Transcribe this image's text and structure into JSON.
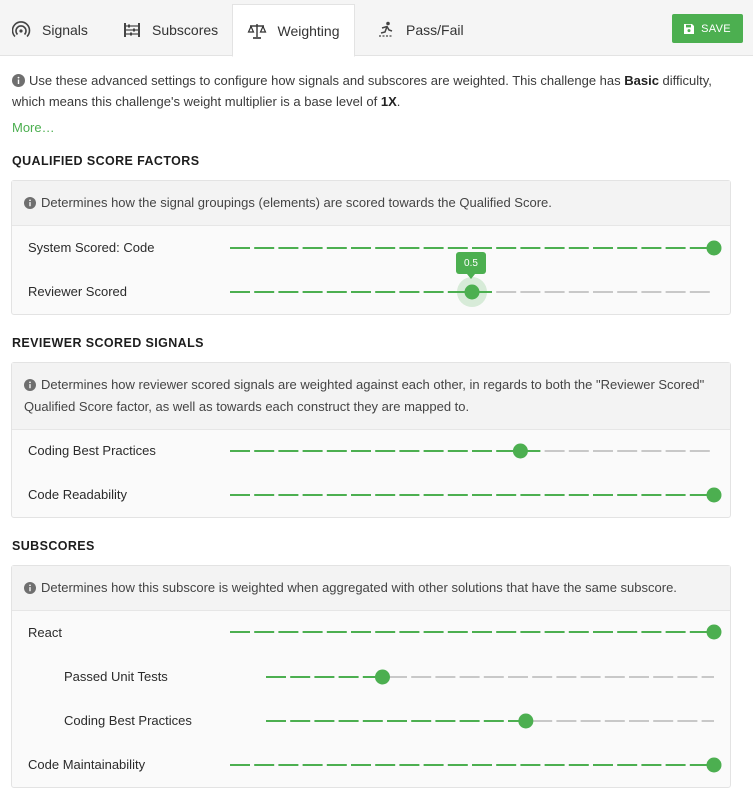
{
  "tabs": [
    {
      "label": "Signals",
      "icon": "signal-icon"
    },
    {
      "label": "Subscores",
      "icon": "abacus-icon"
    },
    {
      "label": "Weighting",
      "icon": "scale-icon"
    },
    {
      "label": "Pass/Fail",
      "icon": "hurdle-icon"
    }
  ],
  "active_tab": "Weighting",
  "save_label": "SAVE",
  "intro": {
    "text_1": "Use these advanced settings to configure how signals and subscores are weighted. This challenge has ",
    "difficulty": "Basic",
    "text_2": " difficulty, which means this challenge's weight multiplier is a base level of ",
    "multiplier": "1X",
    "text_3": ".",
    "more_link": "More…"
  },
  "colors": {
    "accent": "#4caf50",
    "track_inactive": "#c8c8c8"
  },
  "sections": {
    "qualified": {
      "title": "QUALIFIED SCORE FACTORS",
      "note": "Determines how the signal groupings (elements) are scored towards the Qualified Score.",
      "rows": [
        {
          "label": "System Scored: Code",
          "value": 1.0
        },
        {
          "label": "Reviewer Scored",
          "value": 0.5,
          "tooltip": "0.5"
        }
      ]
    },
    "reviewer": {
      "title": "REVIEWER SCORED SIGNALS",
      "note": "Determines how reviewer scored signals are weighted against each other, in regards to both the \"Reviewer Scored\" Qualified Score factor, as well as towards each construct they are mapped to.",
      "rows": [
        {
          "label": "Coding Best Practices",
          "value": 0.6
        },
        {
          "label": "Code Readability",
          "value": 1.0
        }
      ]
    },
    "subscores": {
      "title": "SUBSCORES",
      "note": "Determines how this subscore is weighted when aggregated with other solutions that have the same subscore.",
      "rows": [
        {
          "label": "React",
          "value": 1.0
        },
        {
          "label": "Passed Unit Tests",
          "value": 0.26
        },
        {
          "label": "Coding Best Practices",
          "value": 0.58
        },
        {
          "label": "Code Maintainability",
          "value": 1.0
        }
      ]
    }
  }
}
